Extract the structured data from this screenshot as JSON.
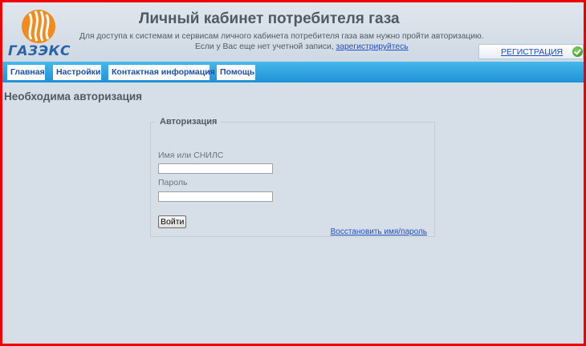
{
  "header": {
    "logo_text": "ГАЗЭКС",
    "title": "Личный кабинет потребителя газа",
    "subtitle": "Для доступа к системам и сервисам личного кабинета потребителя газа вам нужно пройти авторизацию.",
    "no_account_text": "Если у Вас еще нет учетной записи, ",
    "register_link": "зарегистрируйтесь",
    "registration_button": "РЕГИСТРАЦИЯ"
  },
  "nav": {
    "items": [
      {
        "label": "Главная"
      },
      {
        "label": "Настройки"
      },
      {
        "label": "Контактная информация"
      },
      {
        "label": "Помощь"
      }
    ]
  },
  "page": {
    "heading": "Необходима авторизация"
  },
  "auth_form": {
    "legend": "Авторизация",
    "username_label": "Имя или СНИЛС",
    "username_value": "",
    "password_label": "Пароль",
    "password_value": "",
    "submit_label": "Войти",
    "restore_link": "Восстановить имя/пароль"
  },
  "colors": {
    "frame": "#ee0000",
    "navbar": "#2aa3e0",
    "background": "#d6dfe8",
    "link": "#1f4fc0"
  }
}
